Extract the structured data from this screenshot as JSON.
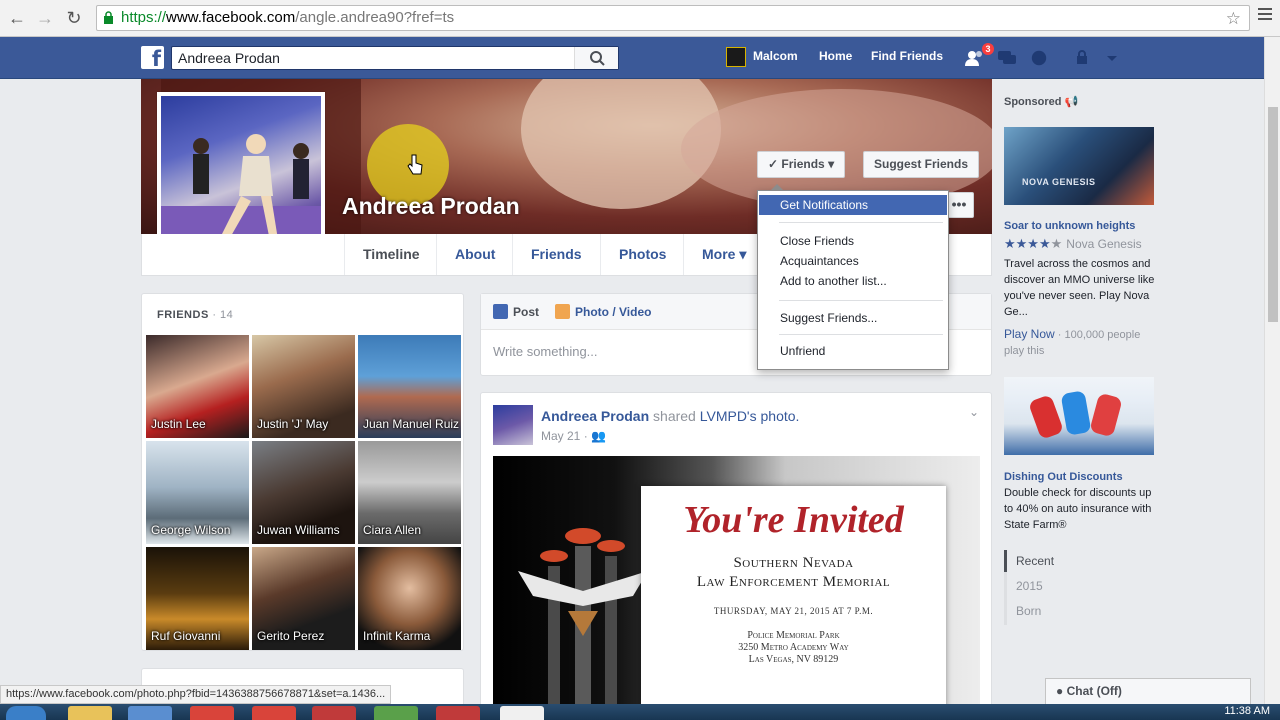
{
  "browser": {
    "url_https": "https://",
    "url_domain": "www.facebook.com",
    "url_path": "/angle.andrea90?fref=ts",
    "status_url": "https://www.facebook.com/photo.php?fbid=1436388756678871&set=a.1436..."
  },
  "topbar": {
    "search_value": "Andreea Prodan",
    "user_name": "Malcom",
    "home": "Home",
    "find_friends": "Find Friends",
    "notification_count": "3"
  },
  "profile": {
    "name": "Andreea Prodan",
    "friends_button": "Friends",
    "suggest_button": "Suggest Friends",
    "more_dots": "•••",
    "tabs": [
      "Timeline",
      "About",
      "Friends",
      "Photos",
      "More"
    ]
  },
  "friends_dropdown": {
    "items": [
      "Get Notifications",
      "Close Friends",
      "Acquaintances",
      "Add to another list...",
      "Suggest Friends...",
      "Unfriend"
    ]
  },
  "friends_box": {
    "title": "FRIENDS",
    "count": " · 14",
    "friends": [
      "Justin Lee",
      "Justin 'J' May",
      "Juan Manuel Ruiz",
      "George Wilson",
      "Juwan Williams",
      "Ciara Allen",
      "Ruf Giovanni",
      "Gerito Perez",
      "Infinit Karma"
    ]
  },
  "composer": {
    "post_tab": "Post",
    "photo_tab": "Photo / Video",
    "placeholder": "Write something..."
  },
  "post": {
    "author": "Andreea Prodan",
    "action": " shared ",
    "shared_link": "LVMPD's photo.",
    "date": "May 21",
    "separator": " · ",
    "invite_title": "You're Invited",
    "invite_line1": "Southern Nevada",
    "invite_line2": "Law Enforcement Memorial",
    "invite_date": "THURSDAY, MAY 21, 2015 AT 7 P.M.",
    "invite_place1": "Police Memorial Park",
    "invite_place2": "3250 Metro Academy Way",
    "invite_place3": "Las Vegas, NV 89129"
  },
  "sidebar": {
    "sponsored": "Sponsored",
    "ad1": {
      "title": "Soar to unknown heights",
      "stars": "★★★★",
      "half_star": "★",
      "advertiser": "Nova Genesis",
      "text": "Travel across the cosmos and discover an MMO universe like you've never seen. Play Nova Ge...",
      "cta": "Play Now",
      "likes": " · 100,000 people play this",
      "logo": "NOVA GENESIS"
    },
    "ad2": {
      "title": "Dishing Out Discounts",
      "text": "Double check for discounts up to 40% on auto insurance with State Farm®"
    },
    "years": [
      "Recent",
      "2015",
      "Born"
    ]
  },
  "chat": {
    "label": "Chat (Off)"
  },
  "taskbar": {
    "clock": "11:38 AM"
  },
  "colors": {
    "fb_blue": "#3b5998",
    "link": "#365899",
    "highlight": "#4267b2"
  }
}
